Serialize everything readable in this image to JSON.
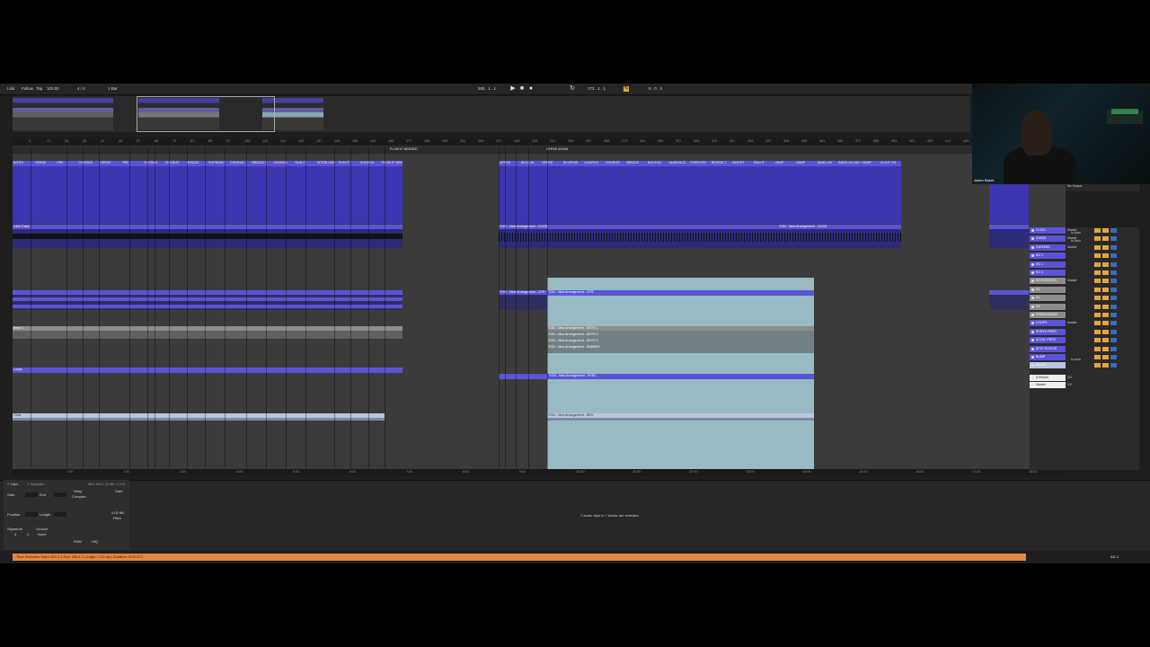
{
  "control_bar": {
    "link": "Link",
    "follow": "Follow",
    "tap": "Tap",
    "tempo": "103.00",
    "time_sig": "4 / 4",
    "quantize": "1 Bar",
    "position": "265 . 1 . 1",
    "loop_start": "173 . 1 . 1",
    "loop_length": "8 . 0 . 0"
  },
  "ruler_marks": [
    "9",
    "17",
    "25",
    "33",
    "41",
    "49",
    "57",
    "65",
    "73",
    "81",
    "89",
    "97",
    "105",
    "113",
    "121",
    "129",
    "137",
    "145",
    "153",
    "161",
    "169",
    "177",
    "185",
    "193",
    "201",
    "209",
    "217",
    "225",
    "233",
    "241",
    "249",
    "257",
    "265",
    "273",
    "281",
    "289",
    "297",
    "305",
    "313",
    "321",
    "329",
    "337",
    "345",
    "353",
    "361",
    "369",
    "377",
    "385",
    "393",
    "401",
    "409",
    "417",
    "425"
  ],
  "locators_left": [
    "INTRO",
    "VERSE",
    "PRE",
    "CHORUS",
    "VERSE",
    "PRE",
    "CHORUS",
    "CHORUS",
    "BRIDGE",
    "SOPRANO",
    "CHORUS",
    "BRIDGE 2",
    "CHORUS",
    "RUN IT",
    "INTERLUDE",
    "RUN IT",
    "CHORUS",
    "FLOW IF NEEDED"
  ],
  "locators_right": [
    "VERSE",
    "BGVS IN",
    "VERSE",
    "IN VERSE",
    "CHORUS",
    "CHORUS",
    "BRIDGE",
    "BGVS IN",
    "AUDIENCE",
    "EVERYON",
    "BRIDGE 2",
    "INVERT",
    "RUN IT",
    "VAMP",
    "VAMP",
    "BANG UH",
    "BANG UH VAMP",
    "+ VAMP",
    "8 OUT ON"
  ],
  "flow_label": "FLOW IF NEEDED",
  "verse_again": "VERSE AGAIN",
  "clips": {
    "click_left": "Click Track",
    "click_right": "YGN - New Arrangement - CLICK",
    "click_right2": "YGN - New Arrangement - CLICK",
    "gtr_right": "YGN - New Arrangement - GTR",
    "keys1": "YGN - New Arrangement - KEYS 1",
    "keys2": "YGN - New Arrangement - KEYS 2",
    "keys3": "YGN - New Arrangement - KEYS 3",
    "rubber": "YGN - New Arrangement - RUBBER",
    "perc": "YGN - New Arrangement - PERC",
    "bgv": "YGN - New Arrangement - BGV",
    "loops": "Loops",
    "keys_left": "Keys 1",
    "choir": "Choir"
  },
  "time_marks": [
    "1:00",
    "2:00",
    "3:00",
    "4:00",
    "5:00",
    "6:00",
    "7:00",
    "8:00",
    "9:00",
    "10:00",
    "11:00",
    "12:00",
    "13:00",
    "14:00",
    "15:00",
    "16:00",
    "17:00",
    "18:00"
  ],
  "mixer": {
    "master_out": "No Output",
    "tracks": [
      {
        "name": "CLICK",
        "color": "#5b53d8",
        "io": "In Auto",
        "io2": "INPUTS",
        "out": "Master"
      },
      {
        "name": "GUIDE",
        "color": "#5b53d8",
        "io": "In Auto",
        "io2": "INPUTS",
        "out": "Master"
      },
      {
        "name": "GUITARS",
        "color": "#5b53d8",
        "io": "",
        "io2": "",
        "out": "Master"
      },
      {
        "name": "AG 1",
        "color": "#5b53d8",
        "io": "",
        "io2": "",
        "out": ""
      },
      {
        "name": "EG 1",
        "color": "#5b53d8",
        "io": "",
        "io2": "",
        "out": ""
      },
      {
        "name": "EG 2",
        "color": "#5b53d8",
        "io": "",
        "io2": "",
        "out": ""
      },
      {
        "name": "KEYS/SYNTH",
        "color": "#8c8c8c",
        "io": "",
        "io2": "",
        "out": "Master"
      },
      {
        "name": "K1",
        "color": "#8c8c8c",
        "io": "",
        "io2": "",
        "out": ""
      },
      {
        "name": "K2",
        "color": "#8c8c8c",
        "io": "",
        "io2": "",
        "out": ""
      },
      {
        "name": "K3",
        "color": "#8c8c8c",
        "io": "",
        "io2": "",
        "out": ""
      },
      {
        "name": "STRINGS/PAD",
        "color": "#8c8c8c",
        "io": "",
        "io2": "",
        "out": ""
      },
      {
        "name": "LOOPS",
        "color": "#5b53d8",
        "io": "",
        "io2": "",
        "out": "Master"
      },
      {
        "name": "SYNTH PERC",
        "color": "#5b53d8",
        "io": "",
        "io2": "",
        "out": ""
      },
      {
        "name": "ACOU. PERC",
        "color": "#5b53d8",
        "io": "",
        "io2": "",
        "out": ""
      },
      {
        "name": "SFX/ TEXTUR",
        "color": "#5b53d8",
        "io": "",
        "io2": "",
        "out": ""
      },
      {
        "name": "BUMP",
        "color": "#5b53d8",
        "io": "In Auto",
        "io2": "LOOPS",
        "out": ""
      },
      {
        "name": "BGVS",
        "color": "#b9c6de",
        "io": "",
        "io2": "",
        "out": ""
      }
    ],
    "returns": [
      {
        "name": "A Return",
        "val": "3/4"
      },
      {
        "name": "Master",
        "val": "1/2"
      }
    ]
  },
  "clip_view": {
    "title": "7 Clips",
    "sub": "7 Samples",
    "start": "Start",
    "end": "End",
    "position": "Position",
    "length": "Length",
    "warp": "Warp",
    "mode": "Complex",
    "signature": "Signature",
    "groove": "Groove",
    "groove_val": "None",
    "sig_num": "4",
    "sig_den": "4",
    "gain": "Gain",
    "gain_val": "0.00 dB",
    "pitch": "Pitch",
    "ram": "RAM",
    "hiq": "HiQ",
    "info": "48.0 kHz / 24 Bit / 2 Ch"
  },
  "center_message": "7 audio clips in 7 tracks are selected.",
  "status_text": "Time Selection    Start: 257.1.1    End: 265.1.1    Length: 1:29.4(c) Duration: 0:02.373",
  "status_right": "AG 1",
  "webcam_name": "Jaden Baker"
}
